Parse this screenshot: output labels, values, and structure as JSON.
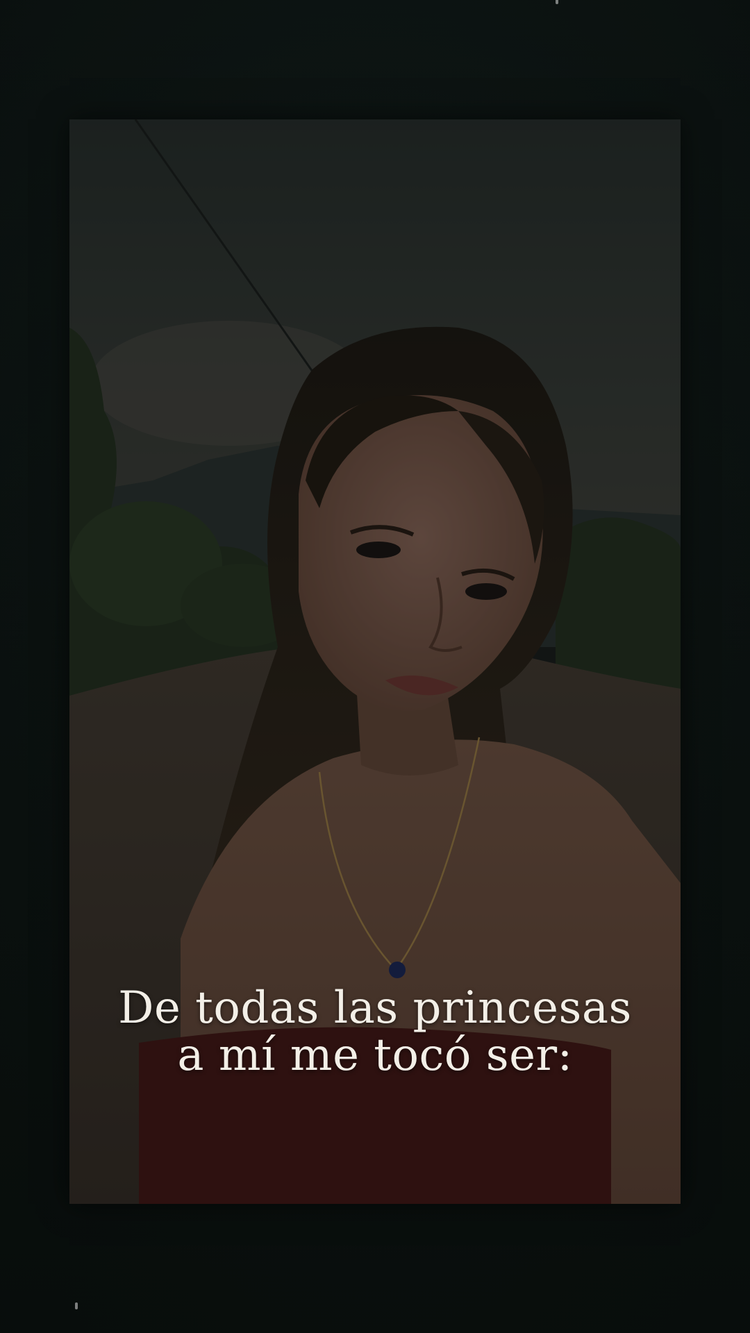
{
  "caption": {
    "line1": "De todas las princesas",
    "line2": "a mí me tocó ser:"
  },
  "photo": {
    "subject": "selfie-portrait",
    "accent_colors": {
      "sky": "#3a3f3a",
      "foliage": "#2c3a26",
      "road": "#4a3a30",
      "skin": "#7a5645",
      "hair": "#22180f",
      "top": "#4a1614",
      "background": "#0c1210"
    }
  }
}
